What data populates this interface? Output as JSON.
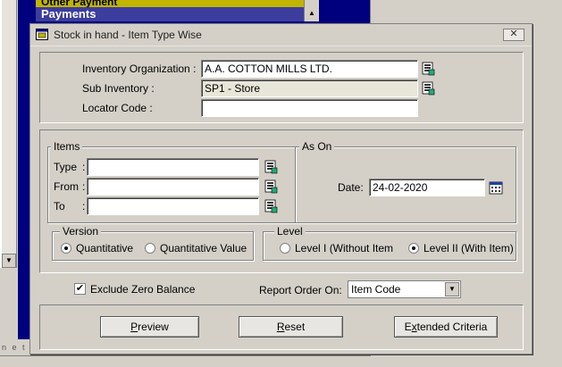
{
  "background": {
    "menu_items": [
      "Other Payment",
      "Payments"
    ],
    "footer_text": "n e t"
  },
  "dialog": {
    "title": "Stock in hand - Item Type Wise",
    "close_glyph": "✕",
    "header": {
      "org_label": "Inventory Organization :",
      "org_value": "A.A. COTTON MILLS LTD.",
      "subinv_label": "Sub Inventory :",
      "subinv_value": "SP1 - Store",
      "locator_label": "Locator Code :",
      "locator_value": ""
    },
    "items": {
      "legend": "Items",
      "type_label": "Type",
      "type_colon": ":",
      "type_value": "",
      "from_label": "From",
      "from_colon": ":",
      "from_value": "",
      "to_label": "To",
      "to_colon": ":",
      "to_value": ""
    },
    "as_on": {
      "legend": "As On",
      "date_label": "Date:",
      "date_value": "24-02-2020"
    },
    "version": {
      "legend": "Version",
      "options": [
        "Quantitative",
        "Quantitative Value"
      ],
      "selected": "Quantitative"
    },
    "level": {
      "legend": "Level",
      "options": [
        "Level I (Without Item",
        "Level II (With Item)"
      ],
      "selected": "Level II (With Item)"
    },
    "exclude_zero_label": "Exclude Zero Balance",
    "exclude_zero_checked": true,
    "check_glyph": "✔",
    "report_order_label": "Report Order On:",
    "report_order_value": "Item Code",
    "buttons": {
      "preview_u": "P",
      "preview_rest": "review",
      "reset_u": "R",
      "reset_rest": "eset",
      "ext_pre": "E",
      "ext_u": "x",
      "ext_rest": "tended Criteria"
    }
  },
  "icons": {
    "lov": "list-of-values-icon",
    "calendar": "calendar-icon",
    "window": "window-icon",
    "dropdown": "chevron-down-icon"
  }
}
